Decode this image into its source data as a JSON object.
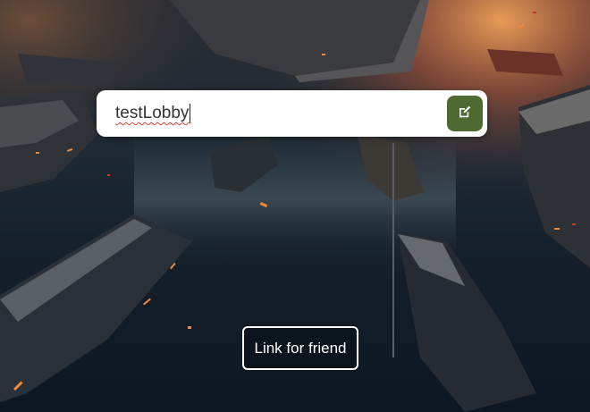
{
  "lobby": {
    "name_value": "testLobby",
    "edit_icon": "edit-icon"
  },
  "share": {
    "link_label": "Link for friend"
  },
  "colors": {
    "edit_button": "#4d6b31",
    "input_background": "#ffffff",
    "link_border": "#ffffff"
  }
}
